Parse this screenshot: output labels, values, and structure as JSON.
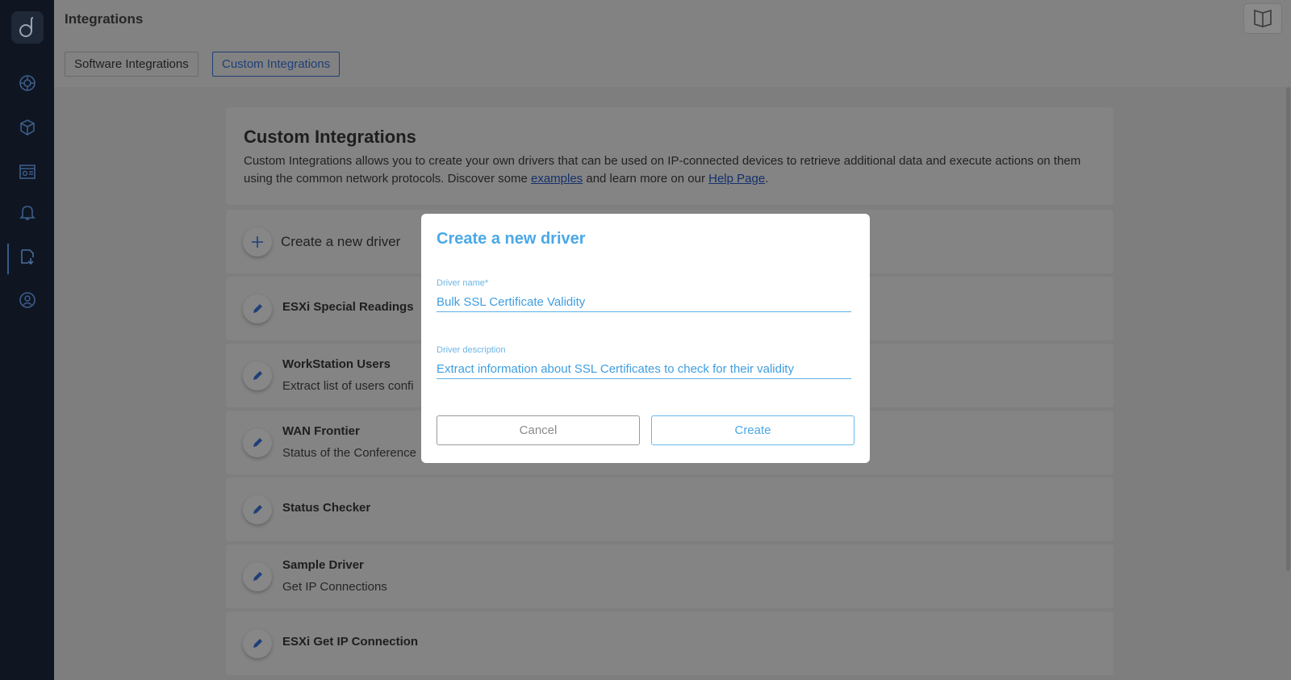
{
  "app": {
    "title": "Integrations"
  },
  "sidebar": {
    "items": [
      {
        "icon": "network-globe-icon"
      },
      {
        "icon": "packages-icon"
      },
      {
        "icon": "dashboard-icon"
      },
      {
        "icon": "bell-icon"
      },
      {
        "icon": "integrations-icon",
        "active": true
      },
      {
        "icon": "user-support-icon"
      }
    ]
  },
  "header": {
    "doc_icon": "open-book-icon",
    "tabs": [
      {
        "label": "Software Integrations"
      },
      {
        "label": "Custom Integrations",
        "active": true
      }
    ]
  },
  "intro": {
    "title": "Custom Integrations",
    "text_before": "Custom Integrations allows you to create your own drivers that can be used on IP-connected devices to retrieve additional data and execute actions on them using the common network protocols. Discover some ",
    "link_examples": "examples",
    "text_middle": " and learn more on our ",
    "link_help": "Help Page",
    "text_after": "."
  },
  "create_row": {
    "label": "Create a new driver",
    "icon": "plus-icon"
  },
  "drivers": [
    {
      "name": "ESXi Special Readings",
      "desc": ""
    },
    {
      "name": "WorkStation Users",
      "desc": "Extract list of users confi"
    },
    {
      "name": "WAN Frontier",
      "desc": "Status of the Conference"
    },
    {
      "name": "Status Checker",
      "desc": ""
    },
    {
      "name": "Sample Driver",
      "desc": "Get IP Connections"
    },
    {
      "name": "ESXi Get IP Connection",
      "desc": ""
    }
  ],
  "modal": {
    "title": "Create a new driver",
    "name_label": "Driver name*",
    "name_value": "Bulk SSL Certificate Validity",
    "desc_label": "Driver description",
    "desc_value": "Extract information about SSL Certificates to check for their validity",
    "cancel_label": "Cancel",
    "create_label": "Create"
  },
  "colors": {
    "accent": "#4aa8e8",
    "sidebar_bg": "#0f1622",
    "overlay": "#808080"
  }
}
